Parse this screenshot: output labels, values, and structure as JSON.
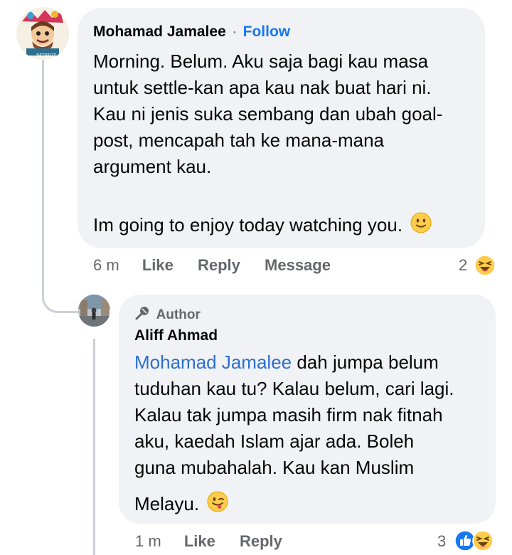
{
  "comment1": {
    "author": "Mohamad Jamalee",
    "separator": "·",
    "follow_label": "Follow",
    "avatar_icon": "cartoon-character-avatar-icon",
    "avatar_caption": "PATRIOT",
    "lines": [
      "Morning. Belum. Aku saja bagi kau masa",
      "untuk settle-kan apa kau nak buat hari ni.",
      "Kau ni jenis suka sembang dan ubah goal-",
      "post, mencapah tah ke mana-mana",
      "argument kau."
    ],
    "last_line": "Im going to enjoy today watching you.",
    "emoji": "slightly-smiling-face-icon",
    "time": "6 m",
    "actions": [
      "Like",
      "Reply",
      "Message"
    ],
    "reaction_count": "2",
    "reaction_icon": "laughing-face-icon"
  },
  "comment2": {
    "badge_icon": "microphone-icon",
    "badge_label": "Author",
    "author": "Aliff Ahmad",
    "avatar_icon": "person-photo-avatar-icon",
    "mention": "Mohamad Jamalee",
    "first_line_rest": " dah jumpa belum",
    "lines": [
      "tuduhan kau tu? Kalau belum, cari lagi.",
      "Kalau tak jumpa masih firm nak fitnah",
      "aku, kaedah Islam ajar ada. Boleh",
      "guna mubahalah. Kau kan Muslim"
    ],
    "last_line": "Melayu.",
    "emoji": "winking-tongue-face-icon",
    "time": "1 m",
    "actions": [
      "Like",
      "Reply"
    ],
    "reaction_count": "3",
    "reaction_icons": [
      "like-icon",
      "laughing-face-icon"
    ]
  },
  "colors": {
    "accent": "#1877f2",
    "bubble": "#f0f2f5",
    "meta": "#65676b",
    "line": "#ccd0d5"
  }
}
